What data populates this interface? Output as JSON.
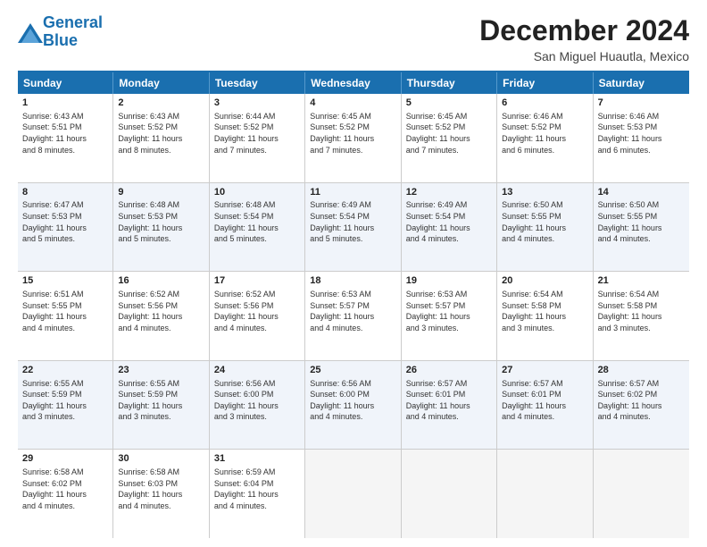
{
  "logo": {
    "line1": "General",
    "line2": "Blue"
  },
  "title": "December 2024",
  "subtitle": "San Miguel Huautla, Mexico",
  "headers": [
    "Sunday",
    "Monday",
    "Tuesday",
    "Wednesday",
    "Thursday",
    "Friday",
    "Saturday"
  ],
  "rows": [
    [
      {
        "day": "1",
        "lines": [
          "Sunrise: 6:43 AM",
          "Sunset: 5:51 PM",
          "Daylight: 11 hours",
          "and 8 minutes."
        ]
      },
      {
        "day": "2",
        "lines": [
          "Sunrise: 6:43 AM",
          "Sunset: 5:52 PM",
          "Daylight: 11 hours",
          "and 8 minutes."
        ]
      },
      {
        "day": "3",
        "lines": [
          "Sunrise: 6:44 AM",
          "Sunset: 5:52 PM",
          "Daylight: 11 hours",
          "and 7 minutes."
        ]
      },
      {
        "day": "4",
        "lines": [
          "Sunrise: 6:45 AM",
          "Sunset: 5:52 PM",
          "Daylight: 11 hours",
          "and 7 minutes."
        ]
      },
      {
        "day": "5",
        "lines": [
          "Sunrise: 6:45 AM",
          "Sunset: 5:52 PM",
          "Daylight: 11 hours",
          "and 7 minutes."
        ]
      },
      {
        "day": "6",
        "lines": [
          "Sunrise: 6:46 AM",
          "Sunset: 5:52 PM",
          "Daylight: 11 hours",
          "and 6 minutes."
        ]
      },
      {
        "day": "7",
        "lines": [
          "Sunrise: 6:46 AM",
          "Sunset: 5:53 PM",
          "Daylight: 11 hours",
          "and 6 minutes."
        ]
      }
    ],
    [
      {
        "day": "8",
        "lines": [
          "Sunrise: 6:47 AM",
          "Sunset: 5:53 PM",
          "Daylight: 11 hours",
          "and 5 minutes."
        ]
      },
      {
        "day": "9",
        "lines": [
          "Sunrise: 6:48 AM",
          "Sunset: 5:53 PM",
          "Daylight: 11 hours",
          "and 5 minutes."
        ]
      },
      {
        "day": "10",
        "lines": [
          "Sunrise: 6:48 AM",
          "Sunset: 5:54 PM",
          "Daylight: 11 hours",
          "and 5 minutes."
        ]
      },
      {
        "day": "11",
        "lines": [
          "Sunrise: 6:49 AM",
          "Sunset: 5:54 PM",
          "Daylight: 11 hours",
          "and 5 minutes."
        ]
      },
      {
        "day": "12",
        "lines": [
          "Sunrise: 6:49 AM",
          "Sunset: 5:54 PM",
          "Daylight: 11 hours",
          "and 4 minutes."
        ]
      },
      {
        "day": "13",
        "lines": [
          "Sunrise: 6:50 AM",
          "Sunset: 5:55 PM",
          "Daylight: 11 hours",
          "and 4 minutes."
        ]
      },
      {
        "day": "14",
        "lines": [
          "Sunrise: 6:50 AM",
          "Sunset: 5:55 PM",
          "Daylight: 11 hours",
          "and 4 minutes."
        ]
      }
    ],
    [
      {
        "day": "15",
        "lines": [
          "Sunrise: 6:51 AM",
          "Sunset: 5:55 PM",
          "Daylight: 11 hours",
          "and 4 minutes."
        ]
      },
      {
        "day": "16",
        "lines": [
          "Sunrise: 6:52 AM",
          "Sunset: 5:56 PM",
          "Daylight: 11 hours",
          "and 4 minutes."
        ]
      },
      {
        "day": "17",
        "lines": [
          "Sunrise: 6:52 AM",
          "Sunset: 5:56 PM",
          "Daylight: 11 hours",
          "and 4 minutes."
        ]
      },
      {
        "day": "18",
        "lines": [
          "Sunrise: 6:53 AM",
          "Sunset: 5:57 PM",
          "Daylight: 11 hours",
          "and 4 minutes."
        ]
      },
      {
        "day": "19",
        "lines": [
          "Sunrise: 6:53 AM",
          "Sunset: 5:57 PM",
          "Daylight: 11 hours",
          "and 3 minutes."
        ]
      },
      {
        "day": "20",
        "lines": [
          "Sunrise: 6:54 AM",
          "Sunset: 5:58 PM",
          "Daylight: 11 hours",
          "and 3 minutes."
        ]
      },
      {
        "day": "21",
        "lines": [
          "Sunrise: 6:54 AM",
          "Sunset: 5:58 PM",
          "Daylight: 11 hours",
          "and 3 minutes."
        ]
      }
    ],
    [
      {
        "day": "22",
        "lines": [
          "Sunrise: 6:55 AM",
          "Sunset: 5:59 PM",
          "Daylight: 11 hours",
          "and 3 minutes."
        ]
      },
      {
        "day": "23",
        "lines": [
          "Sunrise: 6:55 AM",
          "Sunset: 5:59 PM",
          "Daylight: 11 hours",
          "and 3 minutes."
        ]
      },
      {
        "day": "24",
        "lines": [
          "Sunrise: 6:56 AM",
          "Sunset: 6:00 PM",
          "Daylight: 11 hours",
          "and 3 minutes."
        ]
      },
      {
        "day": "25",
        "lines": [
          "Sunrise: 6:56 AM",
          "Sunset: 6:00 PM",
          "Daylight: 11 hours",
          "and 4 minutes."
        ]
      },
      {
        "day": "26",
        "lines": [
          "Sunrise: 6:57 AM",
          "Sunset: 6:01 PM",
          "Daylight: 11 hours",
          "and 4 minutes."
        ]
      },
      {
        "day": "27",
        "lines": [
          "Sunrise: 6:57 AM",
          "Sunset: 6:01 PM",
          "Daylight: 11 hours",
          "and 4 minutes."
        ]
      },
      {
        "day": "28",
        "lines": [
          "Sunrise: 6:57 AM",
          "Sunset: 6:02 PM",
          "Daylight: 11 hours",
          "and 4 minutes."
        ]
      }
    ],
    [
      {
        "day": "29",
        "lines": [
          "Sunrise: 6:58 AM",
          "Sunset: 6:02 PM",
          "Daylight: 11 hours",
          "and 4 minutes."
        ]
      },
      {
        "day": "30",
        "lines": [
          "Sunrise: 6:58 AM",
          "Sunset: 6:03 PM",
          "Daylight: 11 hours",
          "and 4 minutes."
        ]
      },
      {
        "day": "31",
        "lines": [
          "Sunrise: 6:59 AM",
          "Sunset: 6:04 PM",
          "Daylight: 11 hours",
          "and 4 minutes."
        ]
      },
      {
        "day": "",
        "lines": []
      },
      {
        "day": "",
        "lines": []
      },
      {
        "day": "",
        "lines": []
      },
      {
        "day": "",
        "lines": []
      }
    ]
  ]
}
